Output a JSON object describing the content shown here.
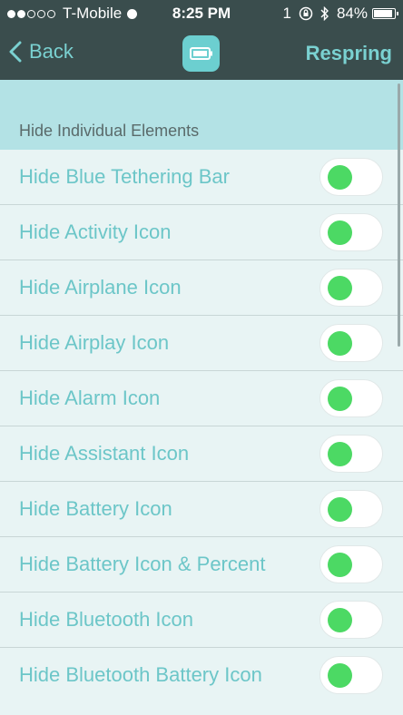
{
  "status_bar": {
    "carrier": "T-Mobile",
    "time": "8:25 PM",
    "indicator": "1",
    "battery_percent": "84%",
    "battery_level": 0.84,
    "signal_bars_filled": 2,
    "signal_bars_total": 5
  },
  "nav": {
    "back_label": "Back",
    "action_label": "Respring",
    "icon": "battery-icon"
  },
  "section": {
    "title": "Hide Individual Elements"
  },
  "rows": [
    {
      "label": "Hide Blue Tethering Bar",
      "on": true
    },
    {
      "label": "Hide Activity Icon",
      "on": true
    },
    {
      "label": "Hide Airplane Icon",
      "on": true
    },
    {
      "label": "Hide Airplay Icon",
      "on": true
    },
    {
      "label": "Hide Alarm Icon",
      "on": true
    },
    {
      "label": "Hide Assistant Icon",
      "on": true
    },
    {
      "label": "Hide Battery Icon",
      "on": true
    },
    {
      "label": "Hide Battery Icon & Percent",
      "on": true
    },
    {
      "label": "Hide Bluetooth Icon",
      "on": true
    },
    {
      "label": "Hide Bluetooth Battery Icon",
      "on": true
    }
  ],
  "colors": {
    "bar_bg": "#3a4d4d",
    "accent": "#7ad1d1",
    "section_bg": "#b3e2e5",
    "list_bg": "#e8f4f4",
    "toggle_knob": "#4cd964"
  }
}
